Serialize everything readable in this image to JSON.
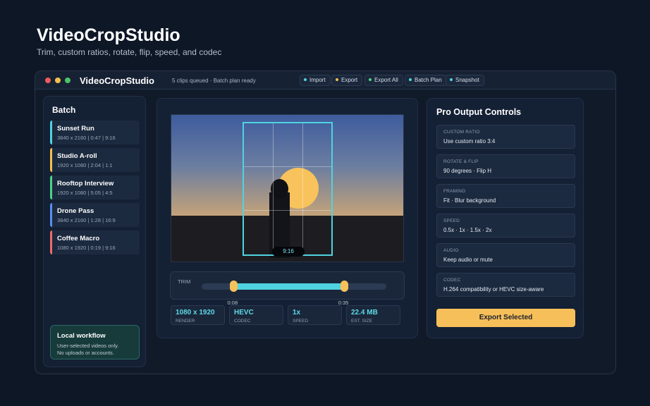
{
  "hero": {
    "title": "VideoCropStudio",
    "subtitle": "Trim, custom ratios, rotate, flip, speed, and codec"
  },
  "window": {
    "app_name": "VideoCropStudio",
    "status": "5 clips queued · Batch plan ready",
    "toolbar": [
      {
        "label": "Import",
        "color": "#4fd3e0"
      },
      {
        "label": "Export",
        "color": "#f5bf4f"
      },
      {
        "label": "Export All",
        "color": "#4cd38a"
      },
      {
        "label": "Batch Plan",
        "color": "#4fd3e0"
      },
      {
        "label": "Snapshot",
        "color": "#4fd3e0"
      }
    ]
  },
  "batch": {
    "title": "Batch",
    "clips": [
      {
        "name": "Sunset Run",
        "meta": "3840 x 2160 | 0:47 | 9:16",
        "accent": "#4fd3e0"
      },
      {
        "name": "Studio A-roll",
        "meta": "1920 x 1080 | 2:04 | 1:1",
        "accent": "#f5bf4f"
      },
      {
        "name": "Rooftop Interview",
        "meta": "1920 x 1080 | 5:05 | 4:5",
        "accent": "#4cd38a"
      },
      {
        "name": "Drone Pass",
        "meta": "3840 x 2160 | 1:28 | 16:9",
        "accent": "#5b8ef0"
      },
      {
        "name": "Coffee Macro",
        "meta": "1080 x 1920 | 0:19 | 9:16",
        "accent": "#ef6b6b"
      }
    ],
    "workflow": {
      "title": "Local workflow",
      "line1": "User-selected videos only.",
      "line2": "No uploads or accounts."
    }
  },
  "preview": {
    "crop_ratio": "9:16"
  },
  "trim": {
    "label": "TRIM",
    "start": "0:08",
    "end": "0:35",
    "start_fraction": 0.17,
    "end_fraction": 0.77
  },
  "stats": [
    {
      "value": "1080 x 1920",
      "label": "RENDER"
    },
    {
      "value": "HEVC",
      "label": "CODEC"
    },
    {
      "value": "1x",
      "label": "SPEED"
    },
    {
      "value": "22.4 MB",
      "label": "EST. SIZE"
    }
  ],
  "controls": {
    "title": "Pro Output Controls",
    "items": [
      {
        "label": "CUSTOM RATIO",
        "value": "Use custom ratio 3:4"
      },
      {
        "label": "ROTATE & FLIP",
        "value": "90 degrees · Flip H"
      },
      {
        "label": "FRAMING",
        "value": "Fit · Blur background"
      },
      {
        "label": "SPEED",
        "value": "0.5x · 1x · 1.5x · 2x"
      },
      {
        "label": "AUDIO",
        "value": "Keep audio or mute"
      },
      {
        "label": "CODEC",
        "value": "H.264 compatibility or HEVC size-aware"
      }
    ],
    "export_label": "Export Selected"
  }
}
